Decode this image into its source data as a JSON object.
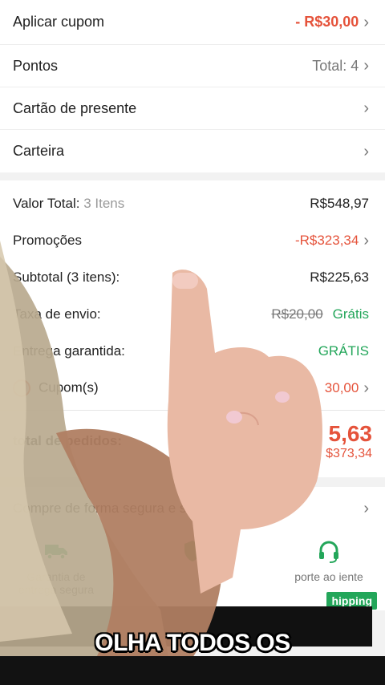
{
  "menu": [
    {
      "label": "Aplicar cupom",
      "value": "- R$30,00",
      "style": "red-strong"
    },
    {
      "label": "Pontos",
      "value": "Total: 4",
      "style": "gray"
    },
    {
      "label": "Cartão de presente",
      "value": "",
      "style": "gray"
    },
    {
      "label": "Carteira",
      "value": "",
      "style": "gray"
    }
  ],
  "summary": {
    "valor_total_label": "Valor Total:",
    "valor_total_items": "3 Itens",
    "valor_total_value": "R$548,97",
    "promocoes_label": "Promoções",
    "promocoes_value": "-R$323,34",
    "subtotal_label": "Subtotal (3 itens):",
    "subtotal_value": "R$225,63",
    "taxa_label": "Taxa de envio:",
    "taxa_original": "R$20,00",
    "taxa_value": "Grátis",
    "entrega_label": "Entrega garantida:",
    "entrega_value": "GRÁTIS",
    "cupom_label": "Cupom(s)",
    "cupom_value": "30,00",
    "total_label": "total de pedidos:",
    "total_value": "5,63",
    "total_original": "$373,34"
  },
  "safe_purchase": "Compre de forma segura e suste",
  "features": [
    {
      "icon": "truck-icon",
      "label": "Garantia de entrega segura"
    },
    {
      "icon": "shield-icon",
      "label": ""
    },
    {
      "icon": "headset-icon",
      "label": "porte ao iente"
    }
  ],
  "shipping_tag": "hipping",
  "caption": "OLHA TODOS OS",
  "colors": {
    "accent_red": "#e5533b",
    "accent_green": "#23a65a"
  }
}
